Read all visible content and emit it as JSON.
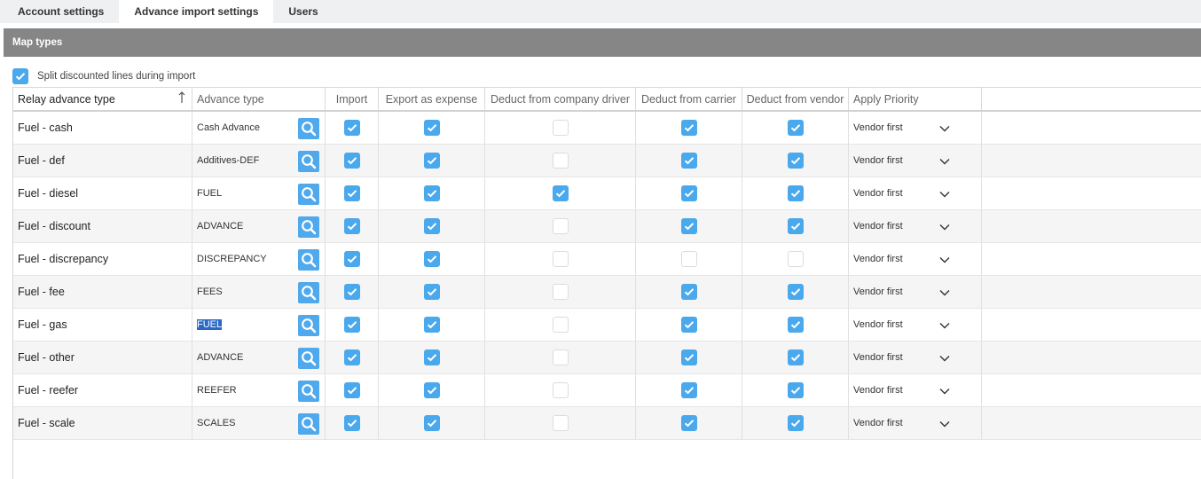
{
  "tabs": [
    {
      "label": "Account settings"
    },
    {
      "label": "Advance import settings"
    },
    {
      "label": "Users"
    }
  ],
  "section": {
    "title": "Map types"
  },
  "split_option": {
    "label": "Split discounted lines during import",
    "checked": true
  },
  "columns": {
    "relay": "Relay advance type",
    "advance": "Advance type",
    "import": "Import",
    "export": "Export as expense",
    "driver": "Deduct from company driver",
    "carrier": "Deduct from carrier",
    "vendor": "Deduct from vendor",
    "priority": "Apply Priority"
  },
  "rows": [
    {
      "relay": "Fuel - cash",
      "advance": "Cash Advance",
      "import": true,
      "export": true,
      "driver": false,
      "carrier": true,
      "vendor": true,
      "priority": "Vendor first"
    },
    {
      "relay": "Fuel - def",
      "advance": "Additives-DEF",
      "import": true,
      "export": true,
      "driver": false,
      "carrier": true,
      "vendor": true,
      "priority": "Vendor first"
    },
    {
      "relay": "Fuel - diesel",
      "advance": "FUEL",
      "import": true,
      "export": true,
      "driver": true,
      "carrier": true,
      "vendor": true,
      "priority": "Vendor first"
    },
    {
      "relay": "Fuel - discount",
      "advance": "ADVANCE",
      "import": true,
      "export": true,
      "driver": false,
      "carrier": true,
      "vendor": true,
      "priority": "Vendor first"
    },
    {
      "relay": "Fuel - discrepancy",
      "advance": "DISCREPANCY",
      "import": true,
      "export": true,
      "driver": false,
      "carrier": false,
      "vendor": false,
      "priority": "Vendor first"
    },
    {
      "relay": "Fuel - fee",
      "advance": "FEES",
      "import": true,
      "export": true,
      "driver": false,
      "carrier": true,
      "vendor": true,
      "priority": "Vendor first"
    },
    {
      "relay": "Fuel - gas",
      "advance": "FUEL",
      "import": true,
      "export": true,
      "driver": false,
      "carrier": true,
      "vendor": true,
      "priority": "Vendor first",
      "selected": true
    },
    {
      "relay": "Fuel - other",
      "advance": "ADVANCE",
      "import": true,
      "export": true,
      "driver": false,
      "carrier": true,
      "vendor": true,
      "priority": "Vendor first"
    },
    {
      "relay": "Fuel - reefer",
      "advance": "REEFER",
      "import": true,
      "export": true,
      "driver": false,
      "carrier": true,
      "vendor": true,
      "priority": "Vendor first"
    },
    {
      "relay": "Fuel - scale",
      "advance": "SCALES",
      "import": true,
      "export": true,
      "driver": false,
      "carrier": true,
      "vendor": true,
      "priority": "Vendor first"
    }
  ],
  "icons": {
    "lookup": "search-icon",
    "checkbox": "check-icon",
    "dropdown": "chevron-down-icon",
    "sort": "sort-arrow-icon"
  },
  "colors": {
    "accent": "#4aa8ec",
    "header_bar": "#868686",
    "selection": "#2b67c7"
  }
}
